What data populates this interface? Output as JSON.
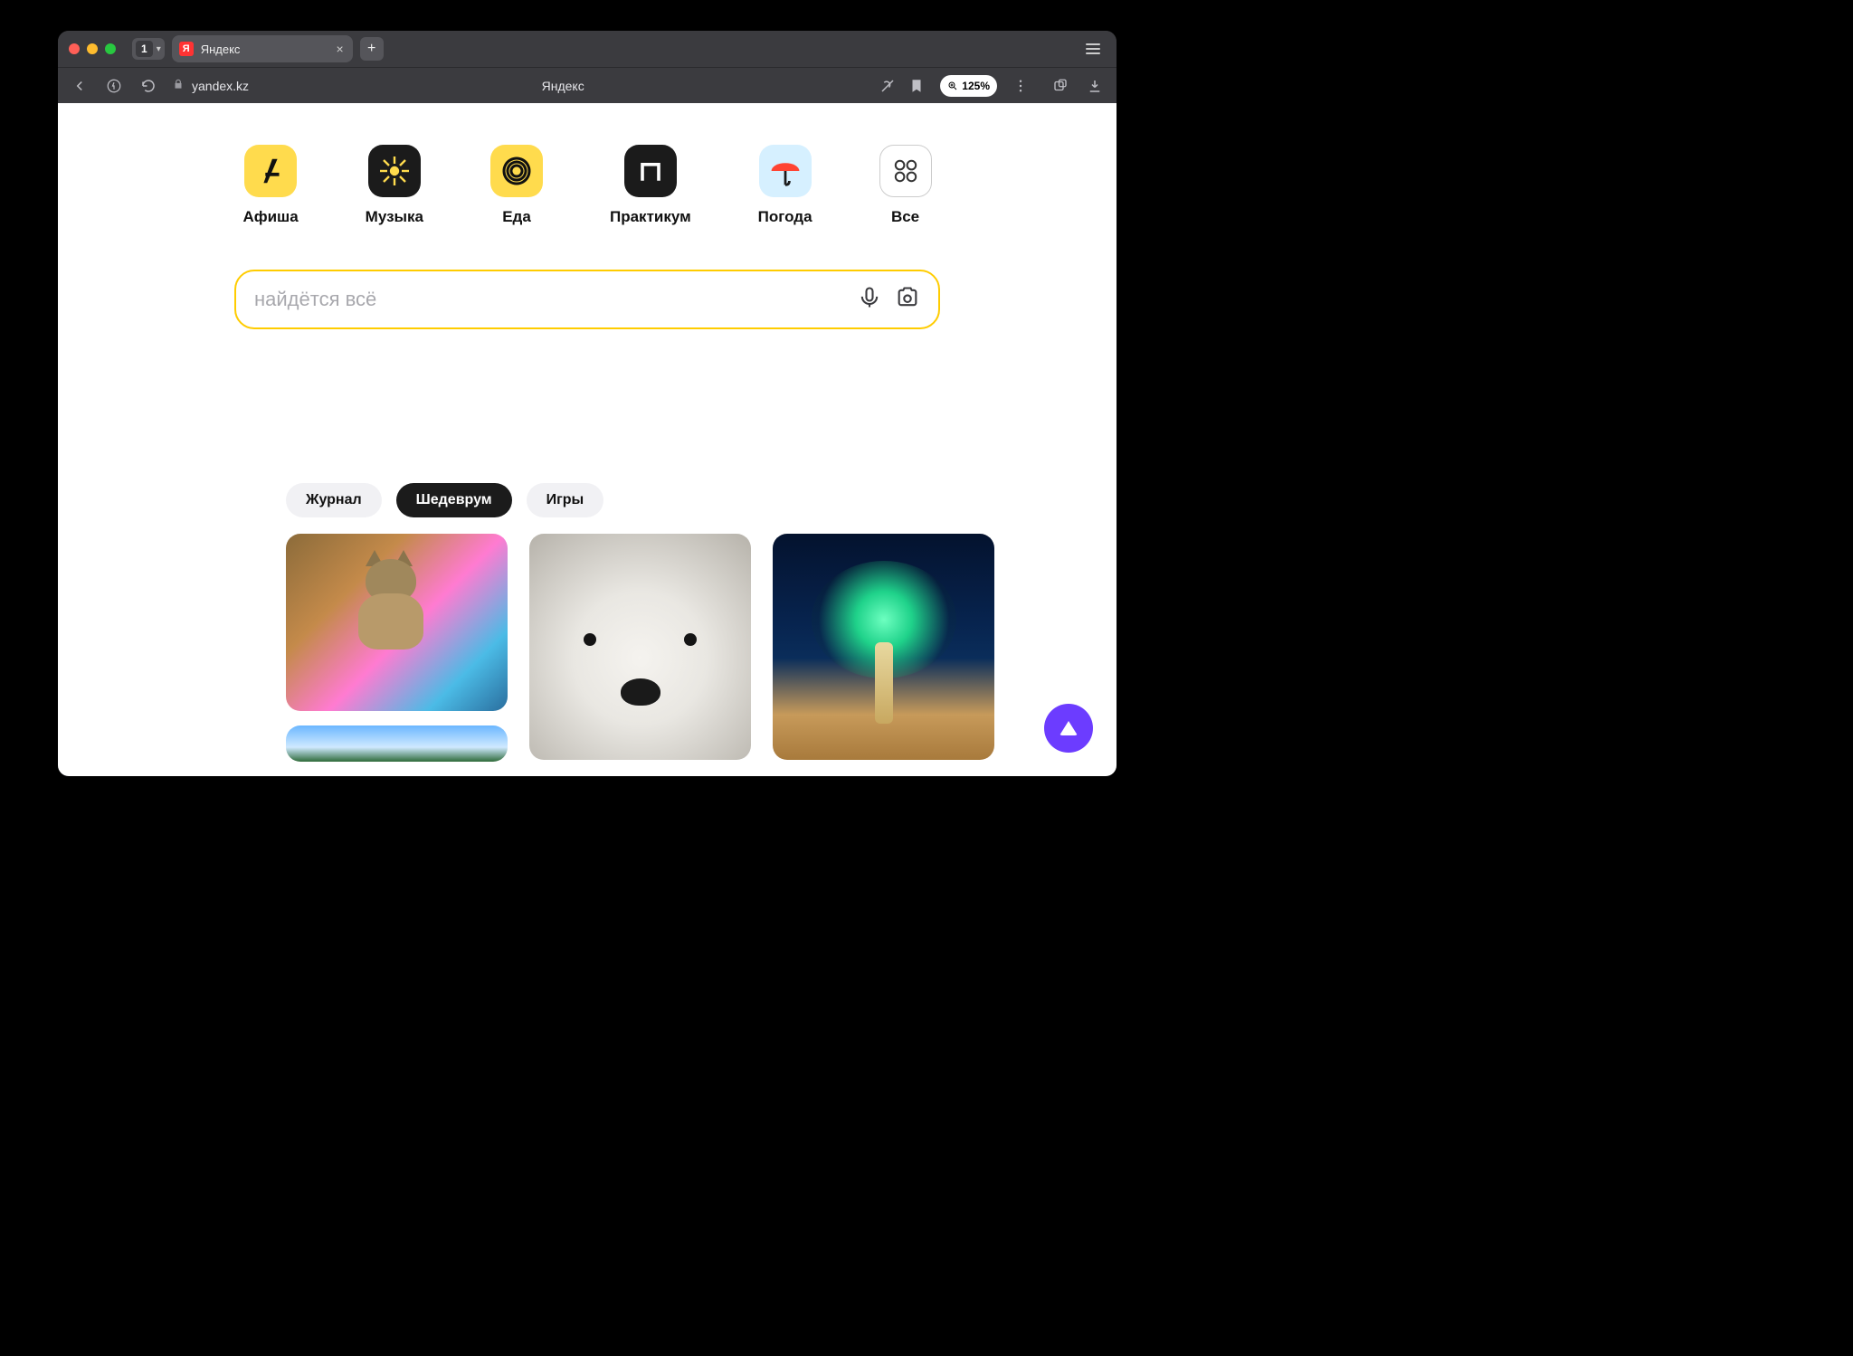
{
  "browser": {
    "tab_count": "1",
    "tab_title": "Яндекс",
    "new_tab_glyph": "+",
    "close_glyph": "×",
    "address_domain": "yandex.kz",
    "page_title_center": "Яндекс",
    "zoom_label": "125%"
  },
  "services": [
    {
      "label": "Афиша"
    },
    {
      "label": "Музыка"
    },
    {
      "label": "Еда"
    },
    {
      "label": "Практикум"
    },
    {
      "label": "Погода"
    },
    {
      "label": "Все"
    }
  ],
  "search": {
    "placeholder": "найдётся всё"
  },
  "feed_tabs": [
    {
      "label": "Журнал",
      "active": false
    },
    {
      "label": "Шедеврум",
      "active": true
    },
    {
      "label": "Игры",
      "active": false
    }
  ],
  "feed_cards": {
    "col1": [
      "kitten-on-painted-map",
      "winter-forest"
    ],
    "col2": [
      "polar-bear-cub"
    ],
    "col3": [
      "glowing-tree-desert-night"
    ]
  }
}
